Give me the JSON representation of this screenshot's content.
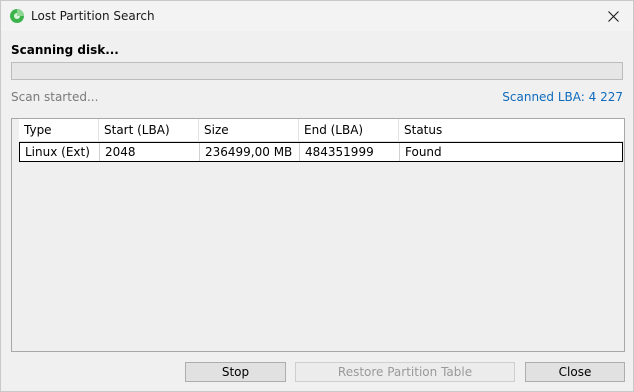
{
  "window": {
    "title": "Lost Partition Search",
    "close_icon": "close-icon",
    "app_icon": "partition-app-icon",
    "colors": {
      "app_icon_green": "#3cb44b",
      "accent_blue": "#0f6cbd"
    }
  },
  "scan": {
    "heading": "Scanning disk...",
    "progress_fraction": 0,
    "status_left": "Scan started...",
    "status_right": "Scanned LBA: 4 227"
  },
  "table": {
    "columns": [
      "Type",
      "Start (LBA)",
      "Size",
      "End (LBA)",
      "Status"
    ],
    "rows": [
      {
        "type": "Linux (Ext)",
        "start": "2048",
        "size": "236499,00 MB",
        "end": "484351999",
        "status": "Found"
      }
    ]
  },
  "buttons": {
    "stop": "Stop",
    "restore": "Restore Partition Table",
    "close": "Close"
  }
}
